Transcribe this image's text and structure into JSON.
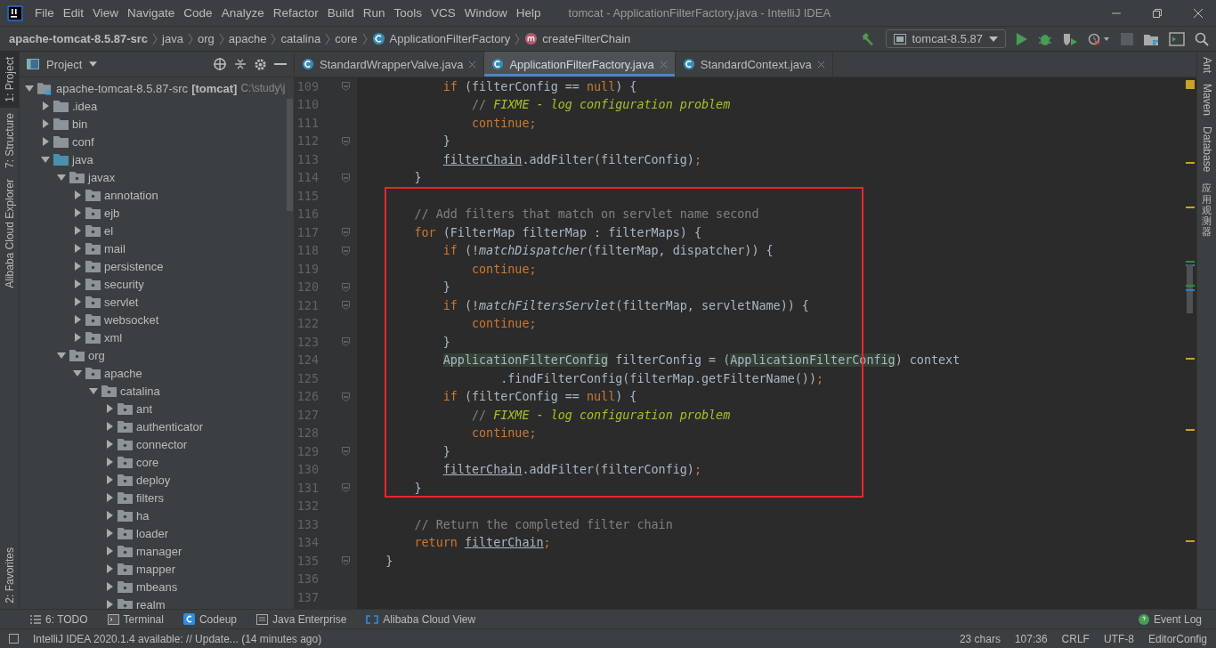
{
  "window": {
    "title": "tomcat - ApplicationFilterFactory.java - IntelliJ IDEA"
  },
  "menu": [
    "File",
    "Edit",
    "View",
    "Navigate",
    "Code",
    "Analyze",
    "Refactor",
    "Build",
    "Run",
    "Tools",
    "VCS",
    "Window",
    "Help"
  ],
  "breadcrumbs": [
    {
      "label": "apache-tomcat-8.5.87-src",
      "kind": "project"
    },
    {
      "label": "java",
      "kind": "dir"
    },
    {
      "label": "org",
      "kind": "dir"
    },
    {
      "label": "apache",
      "kind": "dir"
    },
    {
      "label": "catalina",
      "kind": "dir"
    },
    {
      "label": "core",
      "kind": "dir"
    },
    {
      "label": "ApplicationFilterFactory",
      "kind": "class"
    },
    {
      "label": "createFilterChain",
      "kind": "method"
    }
  ],
  "run_config": "tomcat-8.5.87",
  "left_strip": [
    {
      "label": "1: Project",
      "selected": true
    },
    {
      "label": "7: Structure",
      "selected": false
    },
    {
      "label": "Alibaba Cloud Explorer",
      "selected": false
    },
    {
      "label": "2: Favorites",
      "selected": false
    }
  ],
  "right_strip": [
    {
      "label": "Ant",
      "kind": "latin"
    },
    {
      "label": "Maven",
      "kind": "latin"
    },
    {
      "label": "Database",
      "kind": "latin"
    },
    {
      "label": "应用观测器",
      "kind": "cjk"
    }
  ],
  "project_panel": {
    "title": "Project",
    "tree": [
      {
        "label": "apache-tomcat-8.5.87-src",
        "module": "[tomcat]",
        "path": "C:\\study\\j",
        "kind": "module",
        "expanded": true,
        "children": [
          {
            "label": ".idea",
            "kind": "folder",
            "expanded": false
          },
          {
            "label": "bin",
            "kind": "folder",
            "expanded": false
          },
          {
            "label": "conf",
            "kind": "folder",
            "expanded": false
          },
          {
            "label": "java",
            "kind": "source",
            "expanded": true,
            "children": [
              {
                "label": "javax",
                "kind": "package",
                "expanded": true,
                "children": [
                  {
                    "label": "annotation",
                    "kind": "package",
                    "expanded": false
                  },
                  {
                    "label": "ejb",
                    "kind": "package",
                    "expanded": false
                  },
                  {
                    "label": "el",
                    "kind": "package",
                    "expanded": false
                  },
                  {
                    "label": "mail",
                    "kind": "package",
                    "expanded": false
                  },
                  {
                    "label": "persistence",
                    "kind": "package",
                    "expanded": false
                  },
                  {
                    "label": "security",
                    "kind": "package",
                    "expanded": false
                  },
                  {
                    "label": "servlet",
                    "kind": "package",
                    "expanded": false
                  },
                  {
                    "label": "websocket",
                    "kind": "package",
                    "expanded": false
                  },
                  {
                    "label": "xml",
                    "kind": "package",
                    "expanded": false
                  }
                ]
              },
              {
                "label": "org",
                "kind": "package",
                "expanded": true,
                "children": [
                  {
                    "label": "apache",
                    "kind": "package",
                    "expanded": true,
                    "children": [
                      {
                        "label": "catalina",
                        "kind": "package",
                        "expanded": true,
                        "children": [
                          {
                            "label": "ant",
                            "kind": "package",
                            "expanded": false
                          },
                          {
                            "label": "authenticator",
                            "kind": "package",
                            "expanded": false
                          },
                          {
                            "label": "connector",
                            "kind": "package",
                            "expanded": false
                          },
                          {
                            "label": "core",
                            "kind": "package",
                            "expanded": false
                          },
                          {
                            "label": "deploy",
                            "kind": "package",
                            "expanded": false
                          },
                          {
                            "label": "filters",
                            "kind": "package",
                            "expanded": false
                          },
                          {
                            "label": "ha",
                            "kind": "package",
                            "expanded": false
                          },
                          {
                            "label": "loader",
                            "kind": "package",
                            "expanded": false
                          },
                          {
                            "label": "manager",
                            "kind": "package",
                            "expanded": false
                          },
                          {
                            "label": "mapper",
                            "kind": "package",
                            "expanded": false
                          },
                          {
                            "label": "mbeans",
                            "kind": "package",
                            "expanded": false
                          },
                          {
                            "label": "realm",
                            "kind": "package",
                            "expanded": false
                          }
                        ]
                      }
                    ]
                  }
                ]
              }
            ]
          }
        ]
      }
    ]
  },
  "editor_tabs": [
    {
      "label": "StandardWrapperValve.java",
      "selected": false
    },
    {
      "label": "ApplicationFilterFactory.java",
      "selected": true
    },
    {
      "label": "StandardContext.java",
      "selected": false
    }
  ],
  "code": [
    {
      "n": "109",
      "fold": true,
      "tokens": [
        {
          "t": "if",
          "kind": "keyword"
        },
        {
          "t": " (filterConfig == ",
          "kind": "plain"
        },
        {
          "t": "null",
          "kind": "keyword"
        },
        {
          "t": ") {",
          "kind": "plain"
        }
      ]
    },
    {
      "n": "110",
      "fold": false,
      "tokens": [
        {
          "t": "// ",
          "kind": "comment"
        },
        {
          "t": "FIXME - log configuration problem",
          "kind": "todo"
        }
      ]
    },
    {
      "n": "111",
      "fold": false,
      "tokens": [
        {
          "t": "continue;",
          "kind": "keyword"
        }
      ]
    },
    {
      "n": "112",
      "fold": true,
      "tokens": [
        {
          "t": "}",
          "kind": "plain"
        }
      ]
    },
    {
      "n": "113",
      "fold": false,
      "tokens": [
        {
          "t": "filterChain",
          "kind": "field"
        },
        {
          "t": ".addFilter(filterConfig)",
          "kind": "plain"
        },
        {
          "t": ";",
          "kind": "keyword"
        }
      ]
    },
    {
      "n": "114",
      "fold": true,
      "tokens": [
        {
          "t": "}",
          "kind": "plain"
        }
      ]
    },
    {
      "n": "115",
      "fold": false
    },
    {
      "n": "116",
      "fold": false,
      "tokens": [
        {
          "t": "// Add filters that match on servlet name second",
          "kind": "comment"
        }
      ]
    },
    {
      "n": "117",
      "fold": true,
      "tokens": [
        {
          "t": "for",
          "kind": "keyword"
        },
        {
          "t": " (FilterMap filterMap : filterMaps) {",
          "kind": "plain"
        }
      ]
    },
    {
      "n": "118",
      "fold": true,
      "tokens": [
        {
          "t": "if",
          "kind": "keyword"
        },
        {
          "t": " (!",
          "kind": "plain"
        },
        {
          "t": "matchDispatcher",
          "kind": "static"
        },
        {
          "t": "(filterMap, dispatcher)) {",
          "kind": "plain"
        }
      ]
    },
    {
      "n": "119",
      "fold": false,
      "tokens": [
        {
          "t": "continue;",
          "kind": "keyword"
        }
      ]
    },
    {
      "n": "120",
      "fold": true,
      "tokens": [
        {
          "t": "}",
          "kind": "plain"
        }
      ]
    },
    {
      "n": "121",
      "fold": true,
      "tokens": [
        {
          "t": "if",
          "kind": "keyword"
        },
        {
          "t": " (!",
          "kind": "plain"
        },
        {
          "t": "matchFiltersServlet",
          "kind": "static"
        },
        {
          "t": "(filterMap, servletName)) {",
          "kind": "plain"
        }
      ]
    },
    {
      "n": "122",
      "fold": false,
      "tokens": [
        {
          "t": "continue;",
          "kind": "keyword"
        }
      ]
    },
    {
      "n": "123",
      "fold": true,
      "tokens": [
        {
          "t": "}",
          "kind": "plain"
        }
      ]
    },
    {
      "n": "124",
      "fold": false,
      "tokens": [
        {
          "t": "ApplicationFilterConfig",
          "kind": "usage"
        },
        {
          "t": " filterConfig = (",
          "kind": "plain"
        },
        {
          "t": "ApplicationFilterConfig",
          "kind": "usage"
        },
        {
          "t": ") context",
          "kind": "plain"
        }
      ]
    },
    {
      "n": "125",
      "fold": false,
      "tokens": [
        {
          "t": ".findFilterConfig(filterMap.getFilterName())",
          "kind": "plain"
        },
        {
          "t": ";",
          "kind": "keyword"
        }
      ]
    },
    {
      "n": "126",
      "fold": true,
      "tokens": [
        {
          "t": "if",
          "kind": "keyword"
        },
        {
          "t": " (filterConfig == ",
          "kind": "plain"
        },
        {
          "t": "null",
          "kind": "keyword"
        },
        {
          "t": ") {",
          "kind": "plain"
        }
      ]
    },
    {
      "n": "127",
      "fold": false,
      "tokens": [
        {
          "t": "// ",
          "kind": "comment"
        },
        {
          "t": "FIXME - log configuration problem",
          "kind": "todo"
        }
      ]
    },
    {
      "n": "128",
      "fold": false,
      "tokens": [
        {
          "t": "continue;",
          "kind": "keyword"
        }
      ]
    },
    {
      "n": "129",
      "fold": true,
      "tokens": [
        {
          "t": "}",
          "kind": "plain"
        }
      ]
    },
    {
      "n": "130",
      "fold": false,
      "tokens": [
        {
          "t": "filterChain",
          "kind": "field"
        },
        {
          "t": ".addFilter(filterConfig)",
          "kind": "plain"
        },
        {
          "t": ";",
          "kind": "keyword"
        }
      ]
    },
    {
      "n": "131",
      "fold": true,
      "tokens": [
        {
          "t": "}",
          "kind": "plain"
        }
      ]
    },
    {
      "n": "132",
      "fold": false
    },
    {
      "n": "133",
      "fold": false,
      "tokens": [
        {
          "t": "// Return the completed filter chain",
          "kind": "comment"
        }
      ]
    },
    {
      "n": "134",
      "fold": false,
      "tokens": [
        {
          "t": "return ",
          "kind": "keyword"
        },
        {
          "t": "filterChain",
          "kind": "field"
        },
        {
          "t": ";",
          "kind": "keyword"
        }
      ]
    },
    {
      "n": "135",
      "fold": true,
      "tokens": [
        {
          "t": "}",
          "kind": "plain"
        }
      ]
    },
    {
      "n": "136",
      "fold": false
    },
    {
      "n": "137",
      "fold": false
    }
  ],
  "boxed_lines": [
    false,
    false,
    false,
    false,
    false,
    false,
    true,
    true,
    true,
    true,
    true,
    true,
    true,
    true,
    true,
    true,
    true,
    true,
    true,
    true,
    true,
    true,
    true,
    false,
    false,
    false,
    false,
    false,
    false
  ],
  "bottom_tools": [
    {
      "label": "6: TODO",
      "kind": "todo"
    },
    {
      "label": "Terminal",
      "kind": "terminal"
    },
    {
      "label": "Codeup",
      "kind": "codeup"
    },
    {
      "label": "Java Enterprise",
      "kind": "enterprise"
    },
    {
      "label": "Alibaba Cloud View",
      "kind": "cloud"
    }
  ],
  "event_log": "Event Log",
  "status": {
    "message": "IntelliJ IDEA 2020.1.4 available: // Update... (14 minutes ago)",
    "items": [
      "23 chars",
      "107:36",
      "CRLF",
      "UTF-8",
      "EditorConfig"
    ]
  }
}
